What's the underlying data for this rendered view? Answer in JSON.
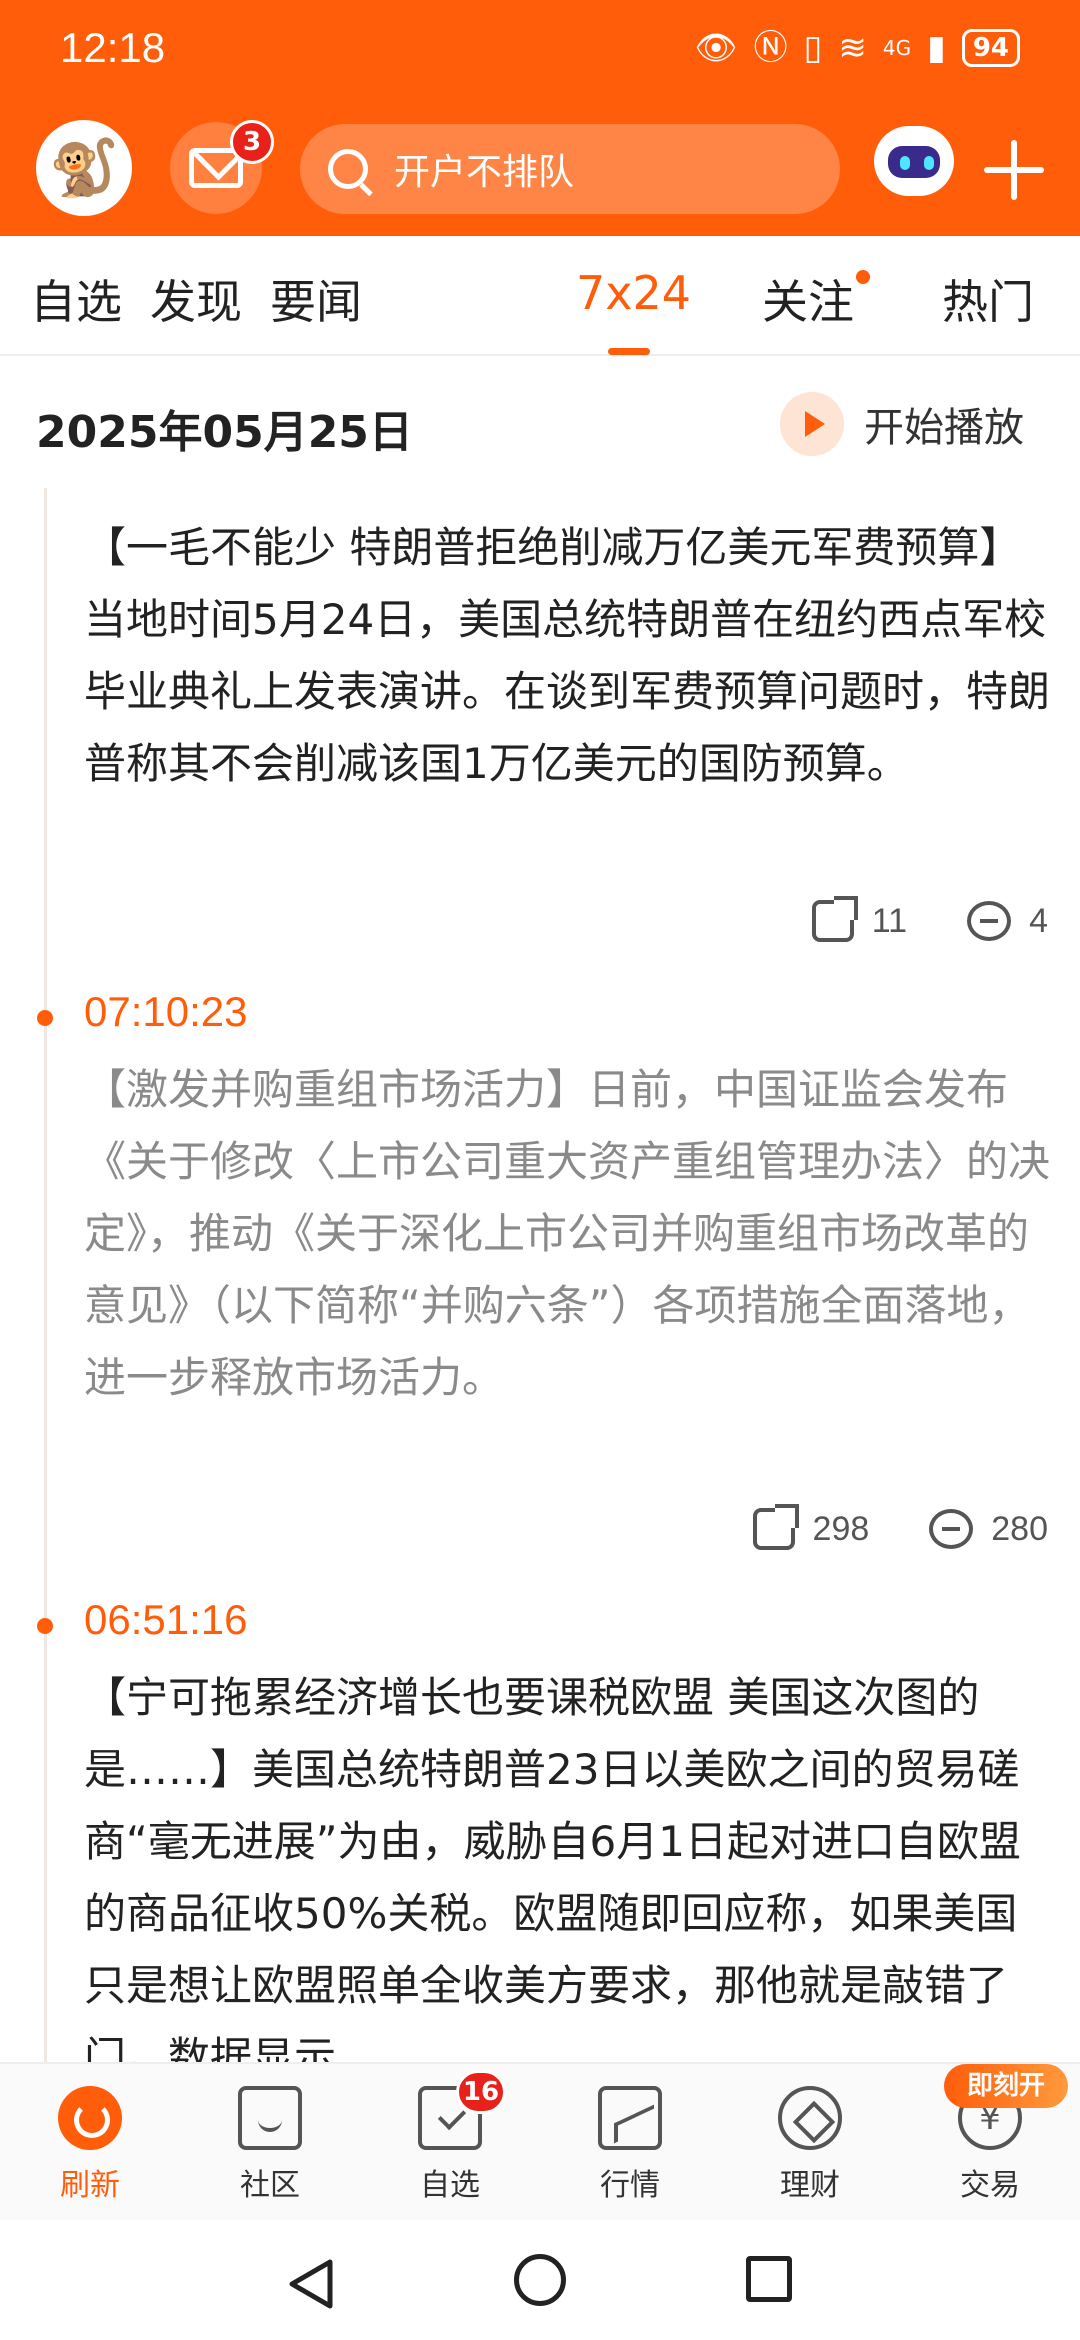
{
  "status": {
    "time": "12:18",
    "battery": "94",
    "network": "4G"
  },
  "header": {
    "mail_badge": "3",
    "search_placeholder": "开户不排队"
  },
  "tabs": [
    {
      "label": "自选"
    },
    {
      "label": "发现"
    },
    {
      "label": "要闻"
    },
    {
      "label": "7x24",
      "active": true
    },
    {
      "label": "关注",
      "dot": true
    },
    {
      "label": "热门"
    }
  ],
  "datebar": {
    "date": "2025年05月25日",
    "play_label": "开始播放"
  },
  "feed": [
    {
      "time": "",
      "text": "【一毛不能少 特朗普拒绝削减万亿美元军费预算】当地时间5月24日，美国总统特朗普在纽约西点军校毕业典礼上发表演讲。在谈到军费预算问题时，特朗普称其不会削减该国1万亿美元的国防预算。",
      "shares": "11",
      "comments": "4"
    },
    {
      "time": "07:10:23",
      "text": "【激发并购重组市场活力】日前，中国证监会发布《关于修改〈上市公司重大资产重组管理办法〉的决定》，推动《关于深化上市公司并购重组市场改革的意见》（以下简称“并购六条”）各项措施全面落地，进一步释放市场活力。",
      "shares": "298",
      "comments": "280"
    },
    {
      "time": "06:51:16",
      "text": "【宁可拖累经济增长也要课税欧盟 美国这次图的是……】美国总统特朗普23日以美欧之间的贸易磋商“毫无进展”为由，威胁自6月1日起对进口自欧盟的商品征收50%关税。欧盟随即回应称，如果美国只是想让欧盟照单全收美方要求，那他就是敲错了门。数据显示"
    }
  ],
  "bottom_nav": [
    {
      "label": "刷新",
      "icon": "refresh-icon",
      "active": true
    },
    {
      "label": "社区",
      "icon": "community-icon"
    },
    {
      "label": "自选",
      "icon": "watchlist-icon",
      "badge": "16"
    },
    {
      "label": "行情",
      "icon": "market-icon"
    },
    {
      "label": "理财",
      "icon": "wealth-icon"
    },
    {
      "label": "交易",
      "icon": "trade-icon",
      "promo": "即刻开"
    }
  ],
  "colors": {
    "brand": "#ff5d0a",
    "badge": "#e8221a"
  }
}
